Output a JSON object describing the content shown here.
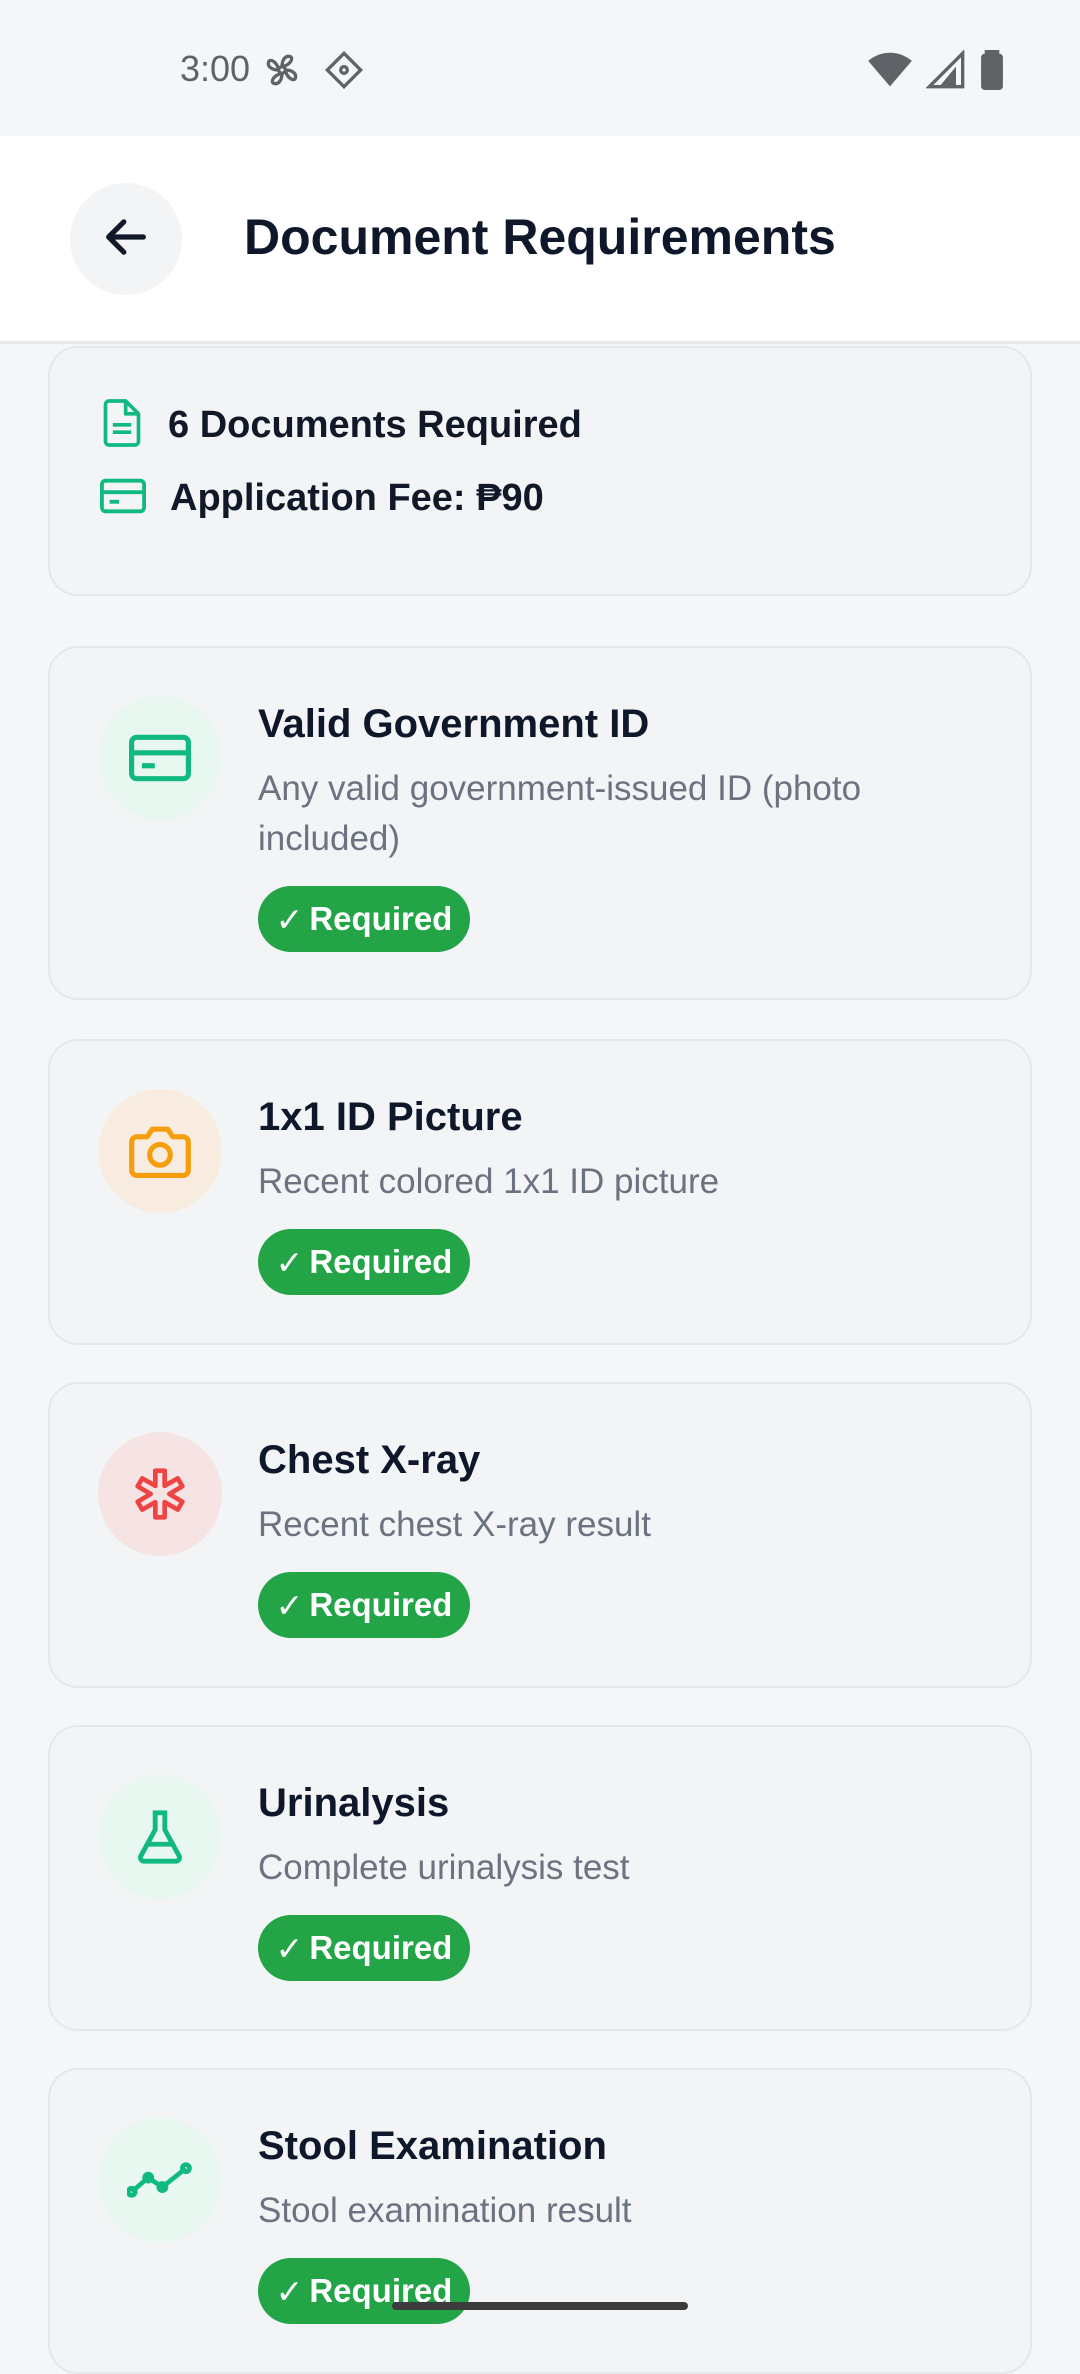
{
  "status_bar": {
    "time": "3:00"
  },
  "app_bar": {
    "title": "Document Requirements"
  },
  "summary": {
    "documents_required": "6 Documents Required",
    "application_fee": "Application Fee: ₱90"
  },
  "documents": [
    {
      "title": "Valid Government ID",
      "description": "Any valid government-issued ID (photo included)",
      "badge": "Required",
      "icon": "id-card-icon",
      "accent": "#10b981"
    },
    {
      "title": "1x1 ID Picture",
      "description": "Recent colored 1x1 ID picture",
      "badge": "Required",
      "icon": "camera-icon",
      "accent": "#f59e0b"
    },
    {
      "title": "Chest X-ray",
      "description": "Recent chest X-ray result",
      "badge": "Required",
      "icon": "asterisk-medical-icon",
      "accent": "#ef4444"
    },
    {
      "title": "Urinalysis",
      "description": "Complete urinalysis test",
      "badge": "Required",
      "icon": "flask-icon",
      "accent": "#10b981"
    },
    {
      "title": "Stool Examination",
      "description": "Stool examination result",
      "badge": "Required",
      "icon": "trend-line-icon",
      "accent": "#10b981"
    }
  ],
  "colors": {
    "badge_green": "#22a447",
    "card_bg": "#f3f4f6",
    "page_bg": "#f5f6f8"
  }
}
